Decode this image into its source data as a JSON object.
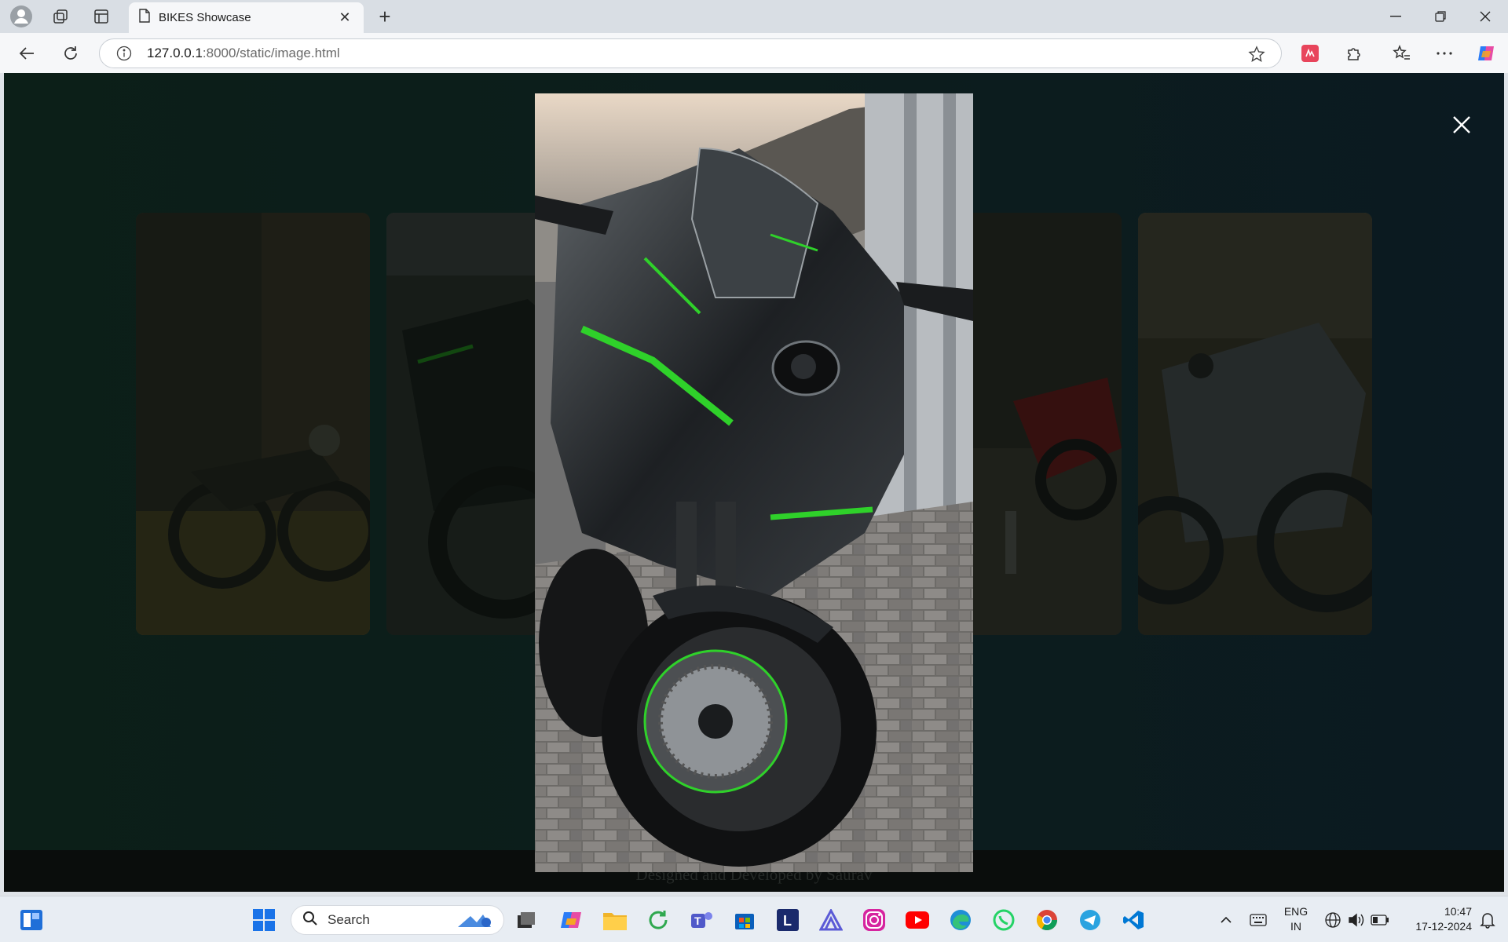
{
  "browser": {
    "tab_title": "BIKES Showcase",
    "url_host": "127.0.0.1",
    "url_path": ":8000/static/image.html"
  },
  "page": {
    "footer_text": "Designed and Developed by Saurav",
    "close_icon": "close-icon",
    "cards": [
      {
        "name": "classic-bike-card"
      },
      {
        "name": "green-sport-bike-card"
      },
      {
        "name": "red-bike-card"
      },
      {
        "name": "grey-superbike-card"
      }
    ],
    "modal_subject": "kawasaki-h2-photo"
  },
  "taskbar": {
    "search_placeholder": "Search",
    "language": "ENG",
    "region": "IN",
    "time": "10:47",
    "date": "17-12-2024"
  },
  "colors": {
    "page_bg": "#0c1e1b",
    "accent_green": "#2fd12a",
    "footer_bg": "#0a0d0c"
  }
}
